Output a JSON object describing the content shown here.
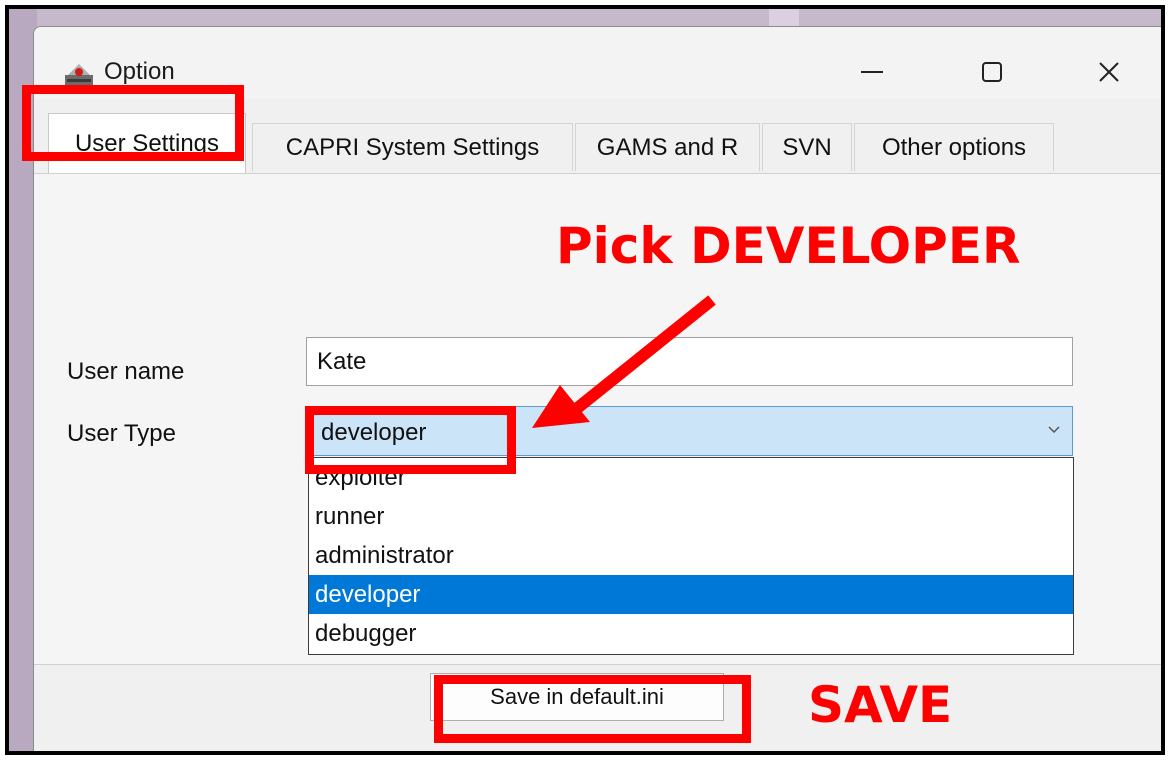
{
  "window": {
    "title": "Option",
    "minimize_glyph": "—",
    "maximize_glyph": "☐",
    "close_glyph": "✕"
  },
  "tabs": [
    {
      "label": "User Settings",
      "active": true
    },
    {
      "label": "CAPRI System Settings",
      "active": false
    },
    {
      "label": "GAMS and R",
      "active": false
    },
    {
      "label": "SVN",
      "active": false
    },
    {
      "label": "Other options",
      "active": false
    }
  ],
  "form": {
    "user_name_label": "User name",
    "user_name_value": "Kate",
    "user_type_label": "User Type",
    "user_type_value": "developer",
    "user_type_options": [
      "exploiter",
      "runner",
      "administrator",
      "developer",
      "debugger"
    ],
    "user_type_selected_index": 3
  },
  "footer": {
    "save_label": "Save in default.ini"
  },
  "annotations": {
    "pick_text": "Pick DEVELOPER",
    "save_text": "SAVE",
    "color": "#ff0000"
  },
  "colors": {
    "selection": "#0078d7",
    "combo_background": "#cce4f7"
  },
  "icons": {
    "app": "capri-app-icon",
    "dropdown": "chevron-down-icon",
    "annotation_arrow": "arrow-icon"
  }
}
